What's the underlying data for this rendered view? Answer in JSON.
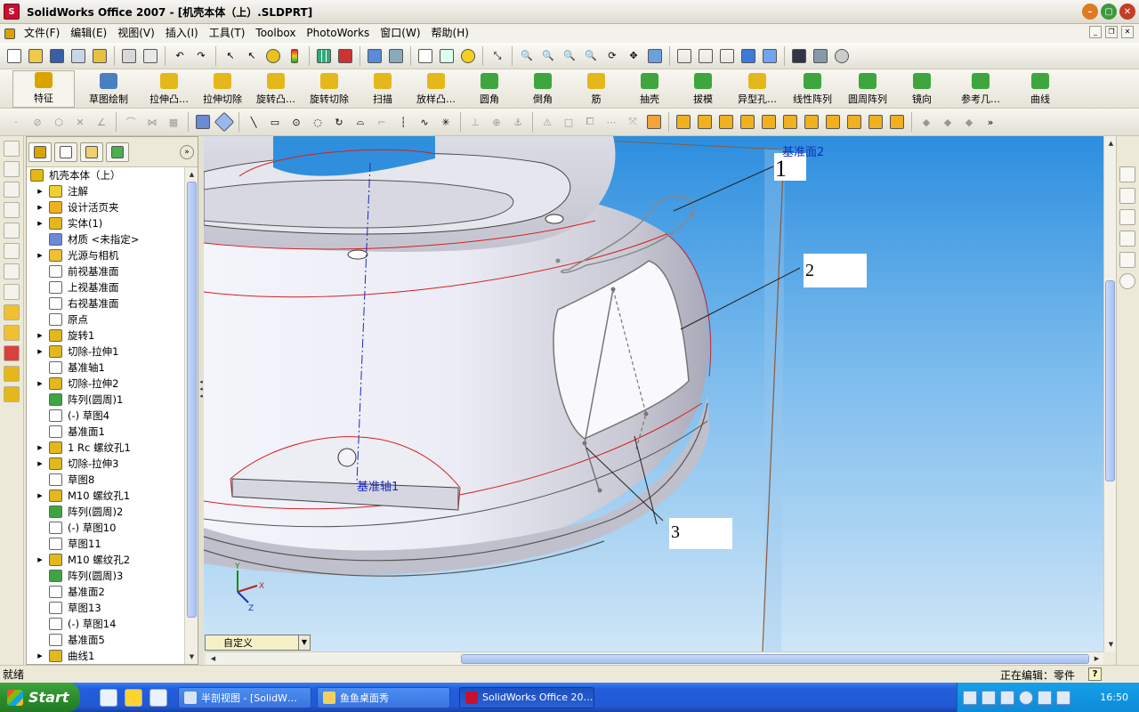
{
  "window": {
    "title": "SolidWorks Office 2007 - [机壳本体（上）.SLDPRT]",
    "icon": "solidworks-logo-icon"
  },
  "menubar": [
    {
      "label": "文件(F)"
    },
    {
      "label": "编辑(E)"
    },
    {
      "label": "视图(V)"
    },
    {
      "label": "插入(I)"
    },
    {
      "label": "工具(T)"
    },
    {
      "label": "Toolbox"
    },
    {
      "label": "PhotoWorks"
    },
    {
      "label": "窗口(W)"
    },
    {
      "label": "帮助(H)"
    }
  ],
  "command_manager": [
    {
      "label": "特征",
      "icon": "features-icon",
      "color": "#d9a400"
    },
    {
      "label": "草图绘制",
      "icon": "sketch-icon",
      "color": "#4a7fc0"
    },
    {
      "label": "拉伸凸…",
      "icon": "extrude-boss-icon",
      "color": "#e4b81b"
    },
    {
      "label": "拉伸切除",
      "icon": "extrude-cut-icon",
      "color": "#e4b81b"
    },
    {
      "label": "旋转凸…",
      "icon": "revolve-boss-icon",
      "color": "#e4b81b"
    },
    {
      "label": "旋转切除",
      "icon": "revolve-cut-icon",
      "color": "#e4b81b"
    },
    {
      "label": "扫描",
      "icon": "sweep-icon",
      "color": "#e4b81b"
    },
    {
      "label": "放样凸…",
      "icon": "loft-icon",
      "color": "#e4b81b"
    },
    {
      "label": "圆角",
      "icon": "fillet-icon",
      "color": "#3fa63f"
    },
    {
      "label": "倒角",
      "icon": "chamfer-icon",
      "color": "#3fa63f"
    },
    {
      "label": "筋",
      "icon": "rib-icon",
      "color": "#e4b81b"
    },
    {
      "label": "抽壳",
      "icon": "shell-icon",
      "color": "#3fa63f"
    },
    {
      "label": "拔模",
      "icon": "draft-icon",
      "color": "#3fa63f"
    },
    {
      "label": "异型孔…",
      "icon": "hole-wizard-icon",
      "color": "#e4b81b"
    },
    {
      "label": "线性阵列",
      "icon": "linear-pattern-icon",
      "color": "#3fa63f"
    },
    {
      "label": "圆周阵列",
      "icon": "circular-pattern-icon",
      "color": "#3fa63f"
    },
    {
      "label": "镜向",
      "icon": "mirror-icon",
      "color": "#3fa63f"
    },
    {
      "label": "参考几…",
      "icon": "reference-geometry-icon",
      "color": "#3fa63f"
    },
    {
      "label": "曲线",
      "icon": "curves-icon",
      "color": "#3fa63f"
    }
  ],
  "feature_tree": {
    "root": "机壳本体（上）",
    "items": [
      {
        "label": "注解",
        "icon": "annotations-icon",
        "expandable": true
      },
      {
        "label": "设计活页夹",
        "icon": "design-binder-icon",
        "expandable": true
      },
      {
        "label": "实体(1)",
        "icon": "solid-bodies-icon",
        "expandable": true
      },
      {
        "label": "材质 <未指定>",
        "icon": "material-icon",
        "expandable": false
      },
      {
        "label": "光源与相机",
        "icon": "lights-cameras-icon",
        "expandable": true
      },
      {
        "label": "前视基准面",
        "icon": "plane-icon",
        "expandable": false
      },
      {
        "label": "上视基准面",
        "icon": "plane-icon",
        "expandable": false
      },
      {
        "label": "右视基准面",
        "icon": "plane-icon",
        "expandable": false
      },
      {
        "label": "原点",
        "icon": "origin-icon",
        "expandable": false
      },
      {
        "label": "旋转1",
        "icon": "revolve-icon",
        "expandable": true
      },
      {
        "label": "切除-拉伸1",
        "icon": "cut-extrude-icon",
        "expandable": true
      },
      {
        "label": "基准轴1",
        "icon": "axis-icon",
        "expandable": false
      },
      {
        "label": "切除-拉伸2",
        "icon": "cut-extrude-icon",
        "expandable": true
      },
      {
        "label": "阵列(圆周)1",
        "icon": "circular-pattern-icon",
        "expandable": false
      },
      {
        "label": "(-) 草图4",
        "icon": "sketch-icon",
        "expandable": false
      },
      {
        "label": "基准面1",
        "icon": "plane-icon",
        "expandable": false
      },
      {
        "label": "1 Rc 螺纹孔1",
        "icon": "hole-icon",
        "expandable": true
      },
      {
        "label": "切除-拉伸3",
        "icon": "cut-extrude-icon",
        "expandable": true
      },
      {
        "label": "草图8",
        "icon": "sketch-icon",
        "expandable": false
      },
      {
        "label": "M10 螺纹孔1",
        "icon": "hole-icon",
        "expandable": true
      },
      {
        "label": "阵列(圆周)2",
        "icon": "circular-pattern-icon",
        "expandable": false
      },
      {
        "label": "(-) 草图10",
        "icon": "sketch-icon",
        "expandable": false
      },
      {
        "label": "草图11",
        "icon": "sketch-icon",
        "expandable": false
      },
      {
        "label": "M10 螺纹孔2",
        "icon": "hole-icon",
        "expandable": true
      },
      {
        "label": "阵列(圆周)3",
        "icon": "circular-pattern-icon",
        "expandable": false
      },
      {
        "label": "基准面2",
        "icon": "plane-icon",
        "expandable": false
      },
      {
        "label": "草图13",
        "icon": "sketch-icon",
        "expandable": false
      },
      {
        "label": "(-) 草图14",
        "icon": "sketch-icon",
        "expandable": false
      },
      {
        "label": "基准面5",
        "icon": "plane-icon",
        "expandable": false
      },
      {
        "label": "曲线1",
        "icon": "curve-icon",
        "expandable": true
      }
    ]
  },
  "viewport": {
    "plane_label": "基准面2",
    "axis_label": "基准轴1",
    "callouts": [
      {
        "label": "1"
      },
      {
        "label": "2"
      },
      {
        "label": "3"
      }
    ],
    "triad": {
      "x": "X",
      "y": "Y",
      "z": "Z"
    },
    "configuration": "自定义"
  },
  "status": {
    "left": "就绪",
    "right": "正在编辑：零件",
    "help": "?"
  },
  "taskbar": {
    "start": "Start",
    "windows": [
      {
        "label": "半剖视图 - [SolidW…",
        "active": false
      },
      {
        "label": "鱼鱼桌面秀",
        "active": false
      },
      {
        "label": "SolidWorks Office 20…",
        "active": true
      }
    ],
    "clock": "16:50"
  }
}
